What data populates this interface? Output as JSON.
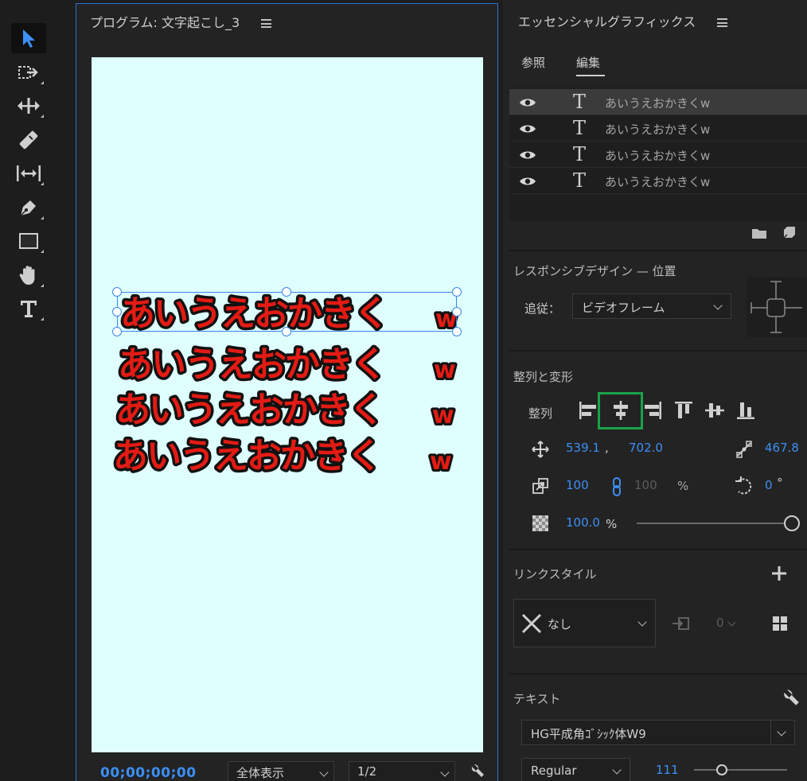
{
  "colors": {
    "accent": "#3c8ff5",
    "highlight": "#1aa34a",
    "canvas": "#defffe",
    "caption": "#e31b14"
  },
  "toolbar": {
    "tools": [
      "selection-tool",
      "track-select-tool",
      "ripple-edit-tool",
      "razor-tool",
      "slip-tool",
      "pen-tool",
      "rectangle-tool",
      "hand-tool",
      "type-tool"
    ],
    "active": "selection-tool"
  },
  "program": {
    "title": "プログラム: 文字起こし_3",
    "captions": [
      {
        "text": "あいうえおかきく",
        "suffix": "w"
      },
      {
        "text": "あいうえおかきく",
        "suffix": "w"
      },
      {
        "text": "あいうえおかきく",
        "suffix": "w"
      },
      {
        "text": "あいうえおかきく",
        "suffix": "w"
      }
    ],
    "timecode": "00;00;00;00",
    "zoom": "全体表示",
    "resolution": "1/2"
  },
  "eg": {
    "title": "エッセンシャルグラフィックス",
    "tabs": {
      "browse": "参照",
      "edit": "編集"
    },
    "layers": [
      {
        "name": "あいうえおかきくw"
      },
      {
        "name": "あいうえおかきくw"
      },
      {
        "name": "あいうえおかきくw"
      },
      {
        "name": "あいうえおかきくw"
      }
    ],
    "responsive": {
      "title": "レスポンシブデザイン — 位置",
      "follow_label": "追従：",
      "follow_value": "ビデオフレーム"
    },
    "align": {
      "title": "整列と変形",
      "label": "整列",
      "pos_x": "539.1",
      "comma": ",",
      "pos_y": "702.0",
      "anchor": "467.8",
      "scale": "100",
      "scale_locked": "100",
      "percent": "%",
      "rotation": "0",
      "degree": "°",
      "opacity": "100.0",
      "opacity_unit": "%",
      "opacity_fraction": 1.0
    },
    "style": {
      "title": "リンクスタイル",
      "value": "なし",
      "count": "0"
    },
    "text": {
      "title": "テキスト",
      "font": "HG平成角ｺﾞｼｯｸ体W9",
      "weight": "Regular",
      "size": "111",
      "size_fraction": 0.3
    }
  }
}
